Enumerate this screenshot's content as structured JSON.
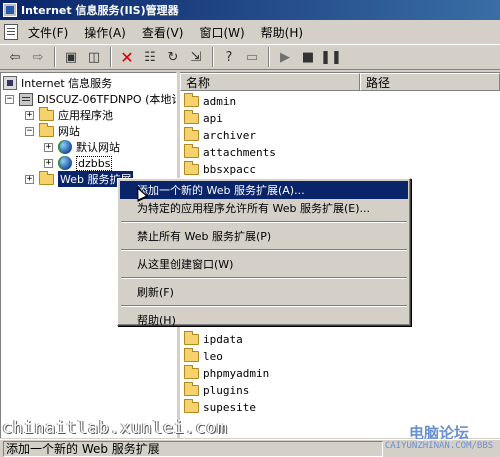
{
  "window": {
    "title": "Internet 信息服务(IIS)管理器"
  },
  "menubar": {
    "items": [
      "文件(F)",
      "操作(A)",
      "查看(V)",
      "窗口(W)",
      "帮助(H)"
    ]
  },
  "toolbar": {
    "buttons": [
      "back-icon",
      "forward-icon",
      "up-folder-icon",
      "show-tree-icon",
      "delete-icon",
      "properties-icon",
      "refresh-icon",
      "export-icon",
      "help-icon",
      "computer-icon",
      "play-icon",
      "stop-icon",
      "pause-icon"
    ]
  },
  "tree": {
    "root": "Internet 信息服务",
    "server": "DISCUZ-06TFDNPO (本地计",
    "app_pools": "应用程序池",
    "websites": "网站",
    "default_site": "默认网站",
    "dzbbs": "dzbbs",
    "web_ext": "Web 服务扩展"
  },
  "list": {
    "columns": [
      "名称",
      "路径"
    ],
    "items_top": [
      "admin",
      "api",
      "archiver",
      "attachments",
      "bbsxpacc"
    ],
    "items_bottom": [
      "ipdata",
      "leo",
      "phpmyadmin",
      "plugins",
      "supesite"
    ]
  },
  "context_menu": {
    "items": [
      "添加一个新的 Web 服务扩展(A)...",
      "为特定的应用程序允许所有 Web 服务扩展(E)...",
      "禁止所有 Web 服务扩展(P)",
      "从这里创建窗口(W)",
      "刷新(F)",
      "帮助(H)"
    ]
  },
  "status": {
    "text": "添加一个新的 Web 服务扩展"
  },
  "watermark": {
    "left": "chinaitlab.xunlei.com",
    "right_logo": "电脑论坛",
    "right_url": "CAIYUNZHINAN.COM/BBS"
  }
}
